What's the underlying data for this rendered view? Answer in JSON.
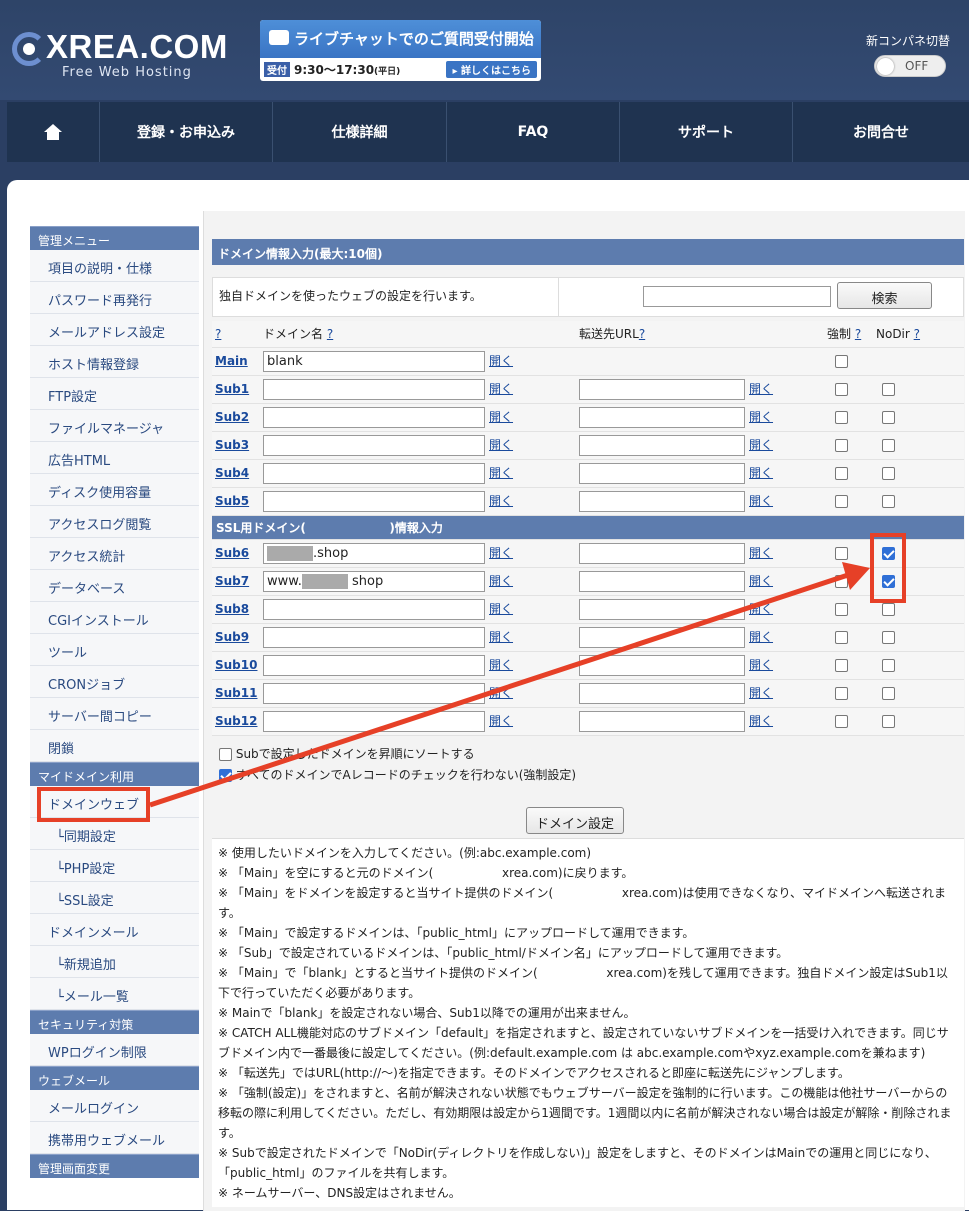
{
  "header": {
    "logo": "XREA.COM",
    "logo_sub": "Free Web Hosting",
    "banner_title": "ライブチャットでのご質問受付開始",
    "banner_tag": "受付",
    "banner_hours": "9:30〜17:30",
    "banner_weekday": "(平日)",
    "banner_more": "▸ 詳しくはこちら",
    "newcp_label": "新コンパネ切替",
    "toggle_label": "OFF"
  },
  "nav": [
    "登録・お申込み",
    "仕様詳細",
    "FAQ",
    "サポート",
    "お問合せ"
  ],
  "sidebar": {
    "sections": [
      {
        "title": "管理メニュー",
        "items": [
          "項目の説明・仕様",
          "パスワード再発行",
          "メールアドレス設定",
          "ホスト情報登録",
          "FTP設定",
          "ファイルマネージャ",
          "広告HTML",
          "ディスク使用容量",
          "アクセスログ閲覧",
          "アクセス統計",
          "データベース",
          "CGIインストール",
          "ツール",
          "CRONジョブ",
          "サーバー間コピー",
          "閉鎖"
        ]
      },
      {
        "title": "マイドメイン利用",
        "items": [
          "ドメインウェブ",
          "└同期設定",
          "└PHP設定",
          "└SSL設定",
          "ドメインメール",
          "└新規追加",
          "└メール一覧"
        ]
      },
      {
        "title": "セキュリティ対策",
        "items": [
          "WPログイン制限"
        ]
      },
      {
        "title": "ウェブメール",
        "items": [
          "メールログイン",
          "携帯用ウェブメール"
        ]
      },
      {
        "title": "管理画面変更",
        "items": []
      }
    ]
  },
  "content": {
    "title": "ドメイン情報入力(最大:10個)",
    "description": "独自ドメインを使ったウェブの設定を行います。",
    "search_button": "検索",
    "col_q": "?",
    "col_domain": "ドメイン名",
    "col_forward": "転送先URL",
    "col_force": "強制",
    "col_nodir": "NoDir",
    "open_label": "開く",
    "ssl_header": "SSL用ドメイン(                    )情報入力",
    "rows": [
      {
        "label": "Main",
        "value": "blank",
        "forward": false,
        "force": false,
        "nodir": null
      },
      {
        "label": "Sub1",
        "value": "",
        "forward": true,
        "force": false,
        "nodir": false
      },
      {
        "label": "Sub2",
        "value": "",
        "forward": true,
        "force": false,
        "nodir": false
      },
      {
        "label": "Sub3",
        "value": "",
        "forward": true,
        "force": false,
        "nodir": false
      },
      {
        "label": "Sub4",
        "value": "",
        "forward": true,
        "force": false,
        "nodir": false
      },
      {
        "label": "Sub5",
        "value": "",
        "forward": true,
        "force": false,
        "nodir": false
      }
    ],
    "ssl_rows": [
      {
        "label": "Sub6",
        "prefix": "",
        "suffix": ".shop",
        "redacted": true,
        "nodir": true
      },
      {
        "label": "Sub7",
        "prefix": "www.",
        "suffix": "shop",
        "redacted": true,
        "nodir": true
      },
      {
        "label": "Sub8",
        "prefix": "",
        "suffix": "",
        "redacted": false,
        "nodir": false
      },
      {
        "label": "Sub9",
        "prefix": "",
        "suffix": "",
        "redacted": false,
        "nodir": false
      },
      {
        "label": "Sub10",
        "prefix": "",
        "suffix": "",
        "redacted": false,
        "nodir": false
      },
      {
        "label": "Sub11",
        "prefix": "",
        "suffix": "",
        "redacted": false,
        "nodir": false
      },
      {
        "label": "Sub12",
        "prefix": "",
        "suffix": "",
        "redacted": false,
        "nodir": false
      }
    ],
    "option_sort": "Subで設定したドメインを昇順にソートする",
    "option_acheck": "すべてのドメインでAレコードのチェックを行わない(強制設定)",
    "submit_button": "ドメイン設定",
    "notes": [
      "※ 使用したいドメインを入力してください。(例:abc.example.com)",
      "※ 「Main」を空にすると元のドメイン(                  xrea.com)に戻ります。",
      "※ 「Main」をドメインを設定すると当サイト提供のドメイン(                  xrea.com)は使用できなくなり、マイドメインへ転送されます。",
      "※ 「Main」で設定するドメインは、「public_html」にアップロードして運用できます。",
      "※ 「Sub」で設定されているドメインは、「public_html/ドメイン名」にアップロードして運用できます。",
      "※ 「Main」で「blank」とすると当サイト提供のドメイン(                  xrea.com)を残して運用できます。独自ドメイン設定はSub1以下で行っていただく必要があります。",
      "※ Mainで「blank」を設定されない場合、Sub1以降での運用が出来ません。",
      "※ CATCH ALL機能対応のサブドメイン「default」を指定されますと、設定されていないサブドメインを一括受け入れできます。同じサブドメイン内で一番最後に設定してください。(例:default.example.com は abc.example.comやxyz.example.comを兼ねます)",
      "※ 「転送先」ではURL(http://〜)を指定できます。そのドメインでアクセスされると即座に転送先にジャンプします。",
      "※ 「強制(設定)」をされますと、名前が解決されない状態でもウェブサーバー設定を強制的に行います。この機能は他社サーバーからの移転の際に利用してください。ただし、有効期限は設定から1週間です。1週間以内に名前が解決されない場合は設定が解除・削除されます。",
      "※ Subで設定されたドメインで「NoDir(ディレクトリを作成しない)」設定をしますと、そのドメインはMainでの運用と同じになり、「public_html」のファイルを共有します。",
      "※ ネームサーバー、DNS設定はされません。"
    ]
  },
  "colors": {
    "accent_red": "#e64027",
    "header_blue": "#5d7cae",
    "nav_dark": "#1f3350"
  }
}
